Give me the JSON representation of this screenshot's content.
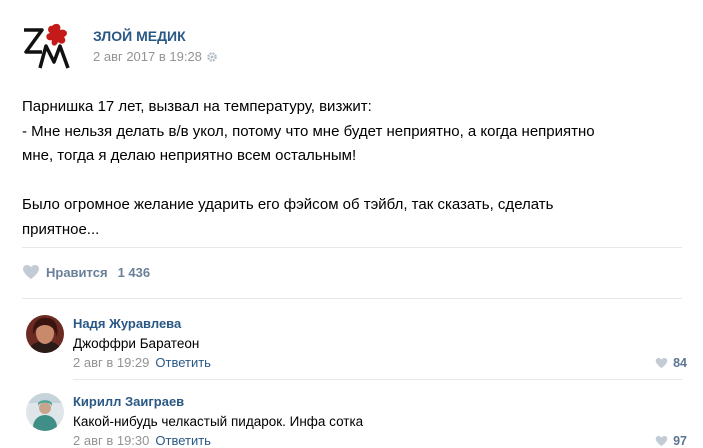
{
  "post": {
    "author": "ЗЛОЙ МЕДИК",
    "date": "2 авг 2017 в 19:28",
    "text_lines": [
      "Парнишка 17 лет, вызвал на температуру, визжит:",
      "- Мне нельзя делать в/в укол, потому что мне будет неприятно, а когда неприятно",
      "мне, тогда я делаю неприятно всем остальным!",
      "Было огромное желание ударить его фэйсом об тэйбл, так сказать, сделать",
      "приятное..."
    ],
    "likes_label": "Нравится",
    "likes_count": "1 436"
  },
  "comments": [
    {
      "author": "Надя Журавлева",
      "text": "Джоффри Баратеон",
      "date": "2 авг в 19:29",
      "reply_label": "Ответить",
      "likes": "84"
    },
    {
      "author": "Кирилл Заиграев",
      "text": "Какой-нибудь челкастый пидарок. Инфа сотка",
      "date": "2 авг в 19:30",
      "reply_label": "Ответить",
      "likes": "97"
    }
  ],
  "colors": {
    "link": "#2a5885",
    "meta": "#939393",
    "like": "#6a7f99",
    "divider": "#e7e8ec",
    "logo_red": "#c41a1a"
  },
  "icons": [
    "gear-icon",
    "heart-icon",
    "logo-icon"
  ]
}
